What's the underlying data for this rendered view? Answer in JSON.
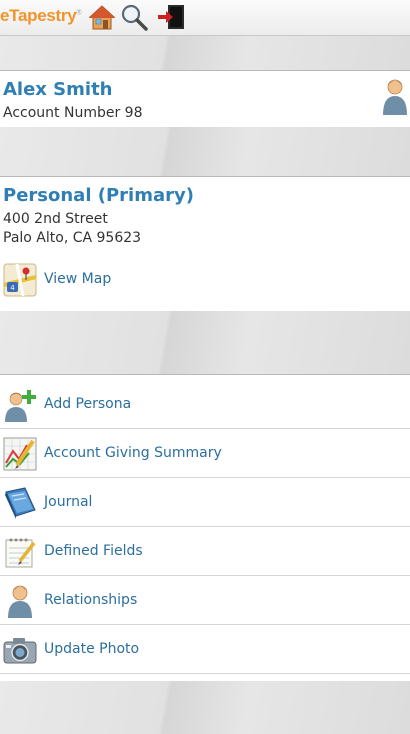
{
  "header": {
    "logo_text": "eTapestry",
    "logo_mark": "®",
    "icons": [
      "home-icon",
      "search-icon",
      "logout-icon"
    ]
  },
  "account": {
    "name": "Alex Smith",
    "account_number": "Account Number 98",
    "icon": "person-icon"
  },
  "address": {
    "title": "Personal (Primary)",
    "line1": "400 2nd Street",
    "line2": "Palo Alto, CA 95623",
    "view_map_label": "View Map",
    "map_icon": "map-icon"
  },
  "actions": [
    {
      "label": "Add Persona",
      "icon": "add-persona-icon"
    },
    {
      "label": "Account Giving Summary",
      "icon": "chart-pencil-icon"
    },
    {
      "label": "Journal",
      "icon": "journal-icon"
    },
    {
      "label": "Defined Fields",
      "icon": "notepad-icon"
    },
    {
      "label": "Relationships",
      "icon": "person-icon"
    },
    {
      "label": "Update Photo",
      "icon": "camera-icon"
    }
  ],
  "colors": {
    "accent_blue": "#2f7fb4",
    "link_blue": "#2b6f9e",
    "logo_orange": "#f0952b"
  }
}
